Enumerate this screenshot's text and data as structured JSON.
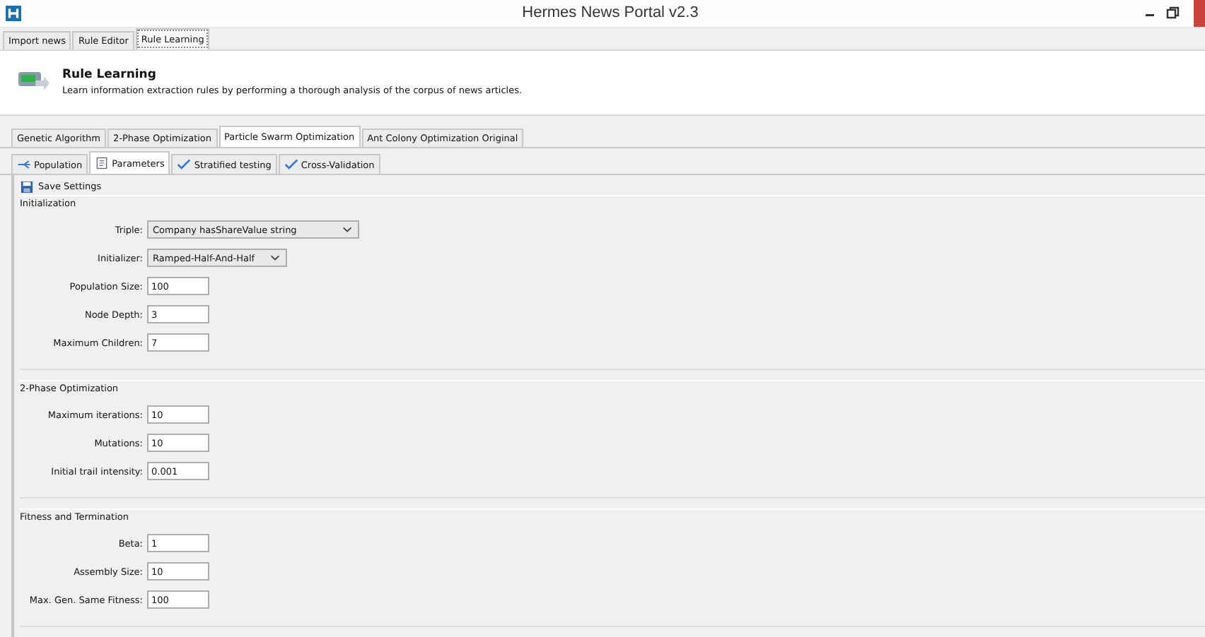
{
  "window": {
    "title": "Hermes News Portal v2.3"
  },
  "main_tabs": [
    {
      "label": "Import news",
      "selected": false
    },
    {
      "label": "Rule Editor",
      "selected": false
    },
    {
      "label": "Rule Learning",
      "selected": true
    }
  ],
  "header": {
    "title": "Rule Learning",
    "description": "Learn information extraction rules by performing a thorough analysis of the corpus of news articles."
  },
  "algorithm_tabs": [
    {
      "label": "Genetic Algorithm",
      "selected": false
    },
    {
      "label": "2-Phase Optimization",
      "selected": false
    },
    {
      "label": "Particle Swarm Optimization",
      "selected": true
    },
    {
      "label": "Ant Colony Optimization Original",
      "selected": false
    }
  ],
  "sub_tabs": [
    {
      "label": "Population",
      "kind": "tree",
      "selected": false
    },
    {
      "label": "Parameters",
      "kind": "document",
      "selected": true
    },
    {
      "label": "Stratified testing",
      "kind": "check",
      "selected": false
    },
    {
      "label": "Cross-Validation",
      "kind": "check",
      "selected": false
    }
  ],
  "toolbar": {
    "save_button": "Save Settings"
  },
  "sections": [
    {
      "title": "Initialization",
      "fields": [
        {
          "label": "Triple:",
          "kind": "select",
          "value": "Company  hasShareValue  string"
        },
        {
          "label": "Initializer:",
          "kind": "select",
          "value": "Ramped-Half-And-Half"
        },
        {
          "label": "Population Size:",
          "kind": "text",
          "value": "100"
        },
        {
          "label": "Node Depth:",
          "kind": "text",
          "value": "3"
        },
        {
          "label": "Maximum Children:",
          "kind": "text",
          "value": "7"
        }
      ]
    },
    {
      "title": "2-Phase Optimization",
      "fields": [
        {
          "label": "Maximum iterations:",
          "kind": "text",
          "value": "10"
        },
        {
          "label": "Mutations:",
          "kind": "text",
          "value": "10"
        },
        {
          "label": "Initial trail intensity:",
          "kind": "text",
          "value": "0.001"
        }
      ]
    },
    {
      "title": "Fitness and Termination",
      "fields": [
        {
          "label": "Beta:",
          "kind": "text",
          "value": "1"
        },
        {
          "label": "Assembly Size:",
          "kind": "text",
          "value": "10"
        },
        {
          "label": "Max. Gen. Same Fitness:",
          "kind": "text",
          "value": "100"
        }
      ]
    }
  ]
}
